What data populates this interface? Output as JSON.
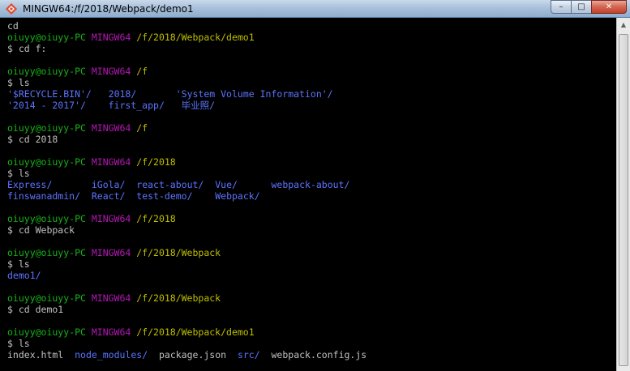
{
  "window": {
    "title": "MINGW64:/f/2018/Webpack/demo1",
    "minimize_glyph": "–",
    "maximize_glyph": "□",
    "close_glyph": "✕",
    "app_icon": "git-bash-icon"
  },
  "colors": {
    "background": "#000000",
    "prompt_user": "#18b218",
    "prompt_msys": "#b218b2",
    "prompt_path": "#bfbf00",
    "directory": "#5c74ff",
    "text": "#c0c0c0"
  },
  "terminal": {
    "lines": [
      [
        {
          "t": "cd",
          "c": "white"
        }
      ],
      [
        {
          "t": "oiuyy@oiuyy-PC ",
          "c": "green"
        },
        {
          "t": "MINGW64 ",
          "c": "magenta"
        },
        {
          "t": "/f/2018/Webpack/demo1",
          "c": "yellow"
        }
      ],
      [
        {
          "t": "$ cd f:",
          "c": "white"
        }
      ],
      [
        {
          "t": "",
          "c": "white"
        }
      ],
      [
        {
          "t": "oiuyy@oiuyy-PC ",
          "c": "green"
        },
        {
          "t": "MINGW64 ",
          "c": "magenta"
        },
        {
          "t": "/f",
          "c": "yellow"
        }
      ],
      [
        {
          "t": "$ ls",
          "c": "white"
        }
      ],
      [
        {
          "t": "'$RECYCLE.BIN'/",
          "c": "blue"
        },
        {
          "t": "   ",
          "c": "white"
        },
        {
          "t": "2018/",
          "c": "blue"
        },
        {
          "t": "       ",
          "c": "white"
        },
        {
          "t": "'System Volume Information'/",
          "c": "blue"
        }
      ],
      [
        {
          "t": "'2014 - 2017'/",
          "c": "blue"
        },
        {
          "t": "    ",
          "c": "white"
        },
        {
          "t": "first_app/",
          "c": "blue"
        },
        {
          "t": "   ",
          "c": "white"
        },
        {
          "t": "毕业照/",
          "c": "blue"
        }
      ],
      [
        {
          "t": "",
          "c": "white"
        }
      ],
      [
        {
          "t": "oiuyy@oiuyy-PC ",
          "c": "green"
        },
        {
          "t": "MINGW64 ",
          "c": "magenta"
        },
        {
          "t": "/f",
          "c": "yellow"
        }
      ],
      [
        {
          "t": "$ cd 2018",
          "c": "white"
        }
      ],
      [
        {
          "t": "",
          "c": "white"
        }
      ],
      [
        {
          "t": "oiuyy@oiuyy-PC ",
          "c": "green"
        },
        {
          "t": "MINGW64 ",
          "c": "magenta"
        },
        {
          "t": "/f/2018",
          "c": "yellow"
        }
      ],
      [
        {
          "t": "$ ls",
          "c": "white"
        }
      ],
      [
        {
          "t": "Express/",
          "c": "blue"
        },
        {
          "t": "       ",
          "c": "white"
        },
        {
          "t": "iGola/",
          "c": "blue"
        },
        {
          "t": "  ",
          "c": "white"
        },
        {
          "t": "react-about/",
          "c": "blue"
        },
        {
          "t": "  ",
          "c": "white"
        },
        {
          "t": "Vue/",
          "c": "blue"
        },
        {
          "t": "      ",
          "c": "white"
        },
        {
          "t": "webpack-about/",
          "c": "blue"
        }
      ],
      [
        {
          "t": "finswanadmin/",
          "c": "blue"
        },
        {
          "t": "  ",
          "c": "white"
        },
        {
          "t": "React/",
          "c": "blue"
        },
        {
          "t": "  ",
          "c": "white"
        },
        {
          "t": "test-demo/",
          "c": "blue"
        },
        {
          "t": "    ",
          "c": "white"
        },
        {
          "t": "Webpack/",
          "c": "blue"
        }
      ],
      [
        {
          "t": "",
          "c": "white"
        }
      ],
      [
        {
          "t": "oiuyy@oiuyy-PC ",
          "c": "green"
        },
        {
          "t": "MINGW64 ",
          "c": "magenta"
        },
        {
          "t": "/f/2018",
          "c": "yellow"
        }
      ],
      [
        {
          "t": "$ cd Webpack",
          "c": "white"
        }
      ],
      [
        {
          "t": "",
          "c": "white"
        }
      ],
      [
        {
          "t": "oiuyy@oiuyy-PC ",
          "c": "green"
        },
        {
          "t": "MINGW64 ",
          "c": "magenta"
        },
        {
          "t": "/f/2018/Webpack",
          "c": "yellow"
        }
      ],
      [
        {
          "t": "$ ls",
          "c": "white"
        }
      ],
      [
        {
          "t": "demo1/",
          "c": "blue"
        }
      ],
      [
        {
          "t": "",
          "c": "white"
        }
      ],
      [
        {
          "t": "oiuyy@oiuyy-PC ",
          "c": "green"
        },
        {
          "t": "MINGW64 ",
          "c": "magenta"
        },
        {
          "t": "/f/2018/Webpack",
          "c": "yellow"
        }
      ],
      [
        {
          "t": "$ cd demo1",
          "c": "white"
        }
      ],
      [
        {
          "t": "",
          "c": "white"
        }
      ],
      [
        {
          "t": "oiuyy@oiuyy-PC ",
          "c": "green"
        },
        {
          "t": "MINGW64 ",
          "c": "magenta"
        },
        {
          "t": "/f/2018/Webpack/demo1",
          "c": "yellow"
        }
      ],
      [
        {
          "t": "$ ls",
          "c": "white"
        }
      ],
      [
        {
          "t": "index.html",
          "c": "white"
        },
        {
          "t": "  ",
          "c": "white"
        },
        {
          "t": "node_modules/",
          "c": "blue"
        },
        {
          "t": "  ",
          "c": "white"
        },
        {
          "t": "package.json",
          "c": "white"
        },
        {
          "t": "  ",
          "c": "white"
        },
        {
          "t": "src/",
          "c": "blue"
        },
        {
          "t": "  ",
          "c": "white"
        },
        {
          "t": "webpack.config.js",
          "c": "white"
        }
      ]
    ]
  },
  "scrollbar": {
    "up_glyph": "▲"
  }
}
